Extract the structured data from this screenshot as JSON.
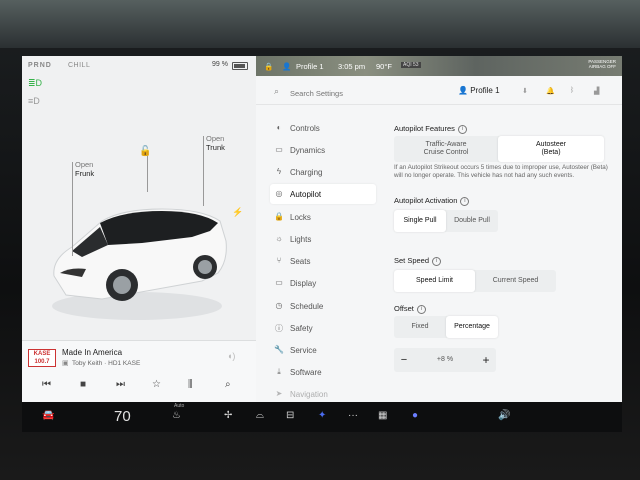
{
  "status": {
    "gears": "PRND",
    "gear_active": "P",
    "mode": "CHILL",
    "battery": "99 %"
  },
  "car": {
    "frunk_top": "Open",
    "frunk_bottom": "Frunk",
    "trunk_top": "Open",
    "trunk_bottom": "Trunk"
  },
  "media": {
    "station_logo": "KASE 100.7",
    "song": "Made In America",
    "artist": "Toby Keith · HD1 KASE"
  },
  "map_bar": {
    "profile": "Profile 1",
    "time": "3:05 pm",
    "temp": "90°F",
    "aqi": "AQI 53",
    "airbag": "PASSENGER AIRBAG OFF"
  },
  "header": {
    "search_placeholder": "Search Settings",
    "profile": "Profile 1"
  },
  "nav": {
    "items": [
      {
        "label": "Controls",
        "icon": "toggle-icon"
      },
      {
        "label": "Dynamics",
        "icon": "car-icon"
      },
      {
        "label": "Charging",
        "icon": "bolt-icon"
      },
      {
        "label": "Autopilot",
        "icon": "steering-wheel-icon"
      },
      {
        "label": "Locks",
        "icon": "lock-icon"
      },
      {
        "label": "Lights",
        "icon": "light-icon"
      },
      {
        "label": "Seats",
        "icon": "seat-icon"
      },
      {
        "label": "Display",
        "icon": "display-icon"
      },
      {
        "label": "Schedule",
        "icon": "clock-icon"
      },
      {
        "label": "Safety",
        "icon": "shield-icon"
      },
      {
        "label": "Service",
        "icon": "wrench-icon"
      },
      {
        "label": "Software",
        "icon": "download-icon"
      },
      {
        "label": "Navigation",
        "icon": "navigation-icon"
      }
    ],
    "active": "Autopilot"
  },
  "autopilot": {
    "features_title": "Autopilot Features",
    "features_opt1": "Traffic-Aware\nCruise Control",
    "features_opt2": "Autosteer\n(Beta)",
    "warning": "If an Autopilot Strikeout occurs 5 times due to improper use, Autosteer (Beta) will no longer operate. This vehicle has not had any such events.",
    "activation_title": "Autopilot Activation",
    "activation_opt1": "Single Pull",
    "activation_opt2": "Double Pull",
    "speed_title": "Set Speed",
    "speed_opt1": "Speed Limit",
    "speed_opt2": "Current Speed",
    "offset_title": "Offset",
    "offset_opt1": "Fixed",
    "offset_opt2": "Percentage",
    "offset_value": "+8 %",
    "offset_minus": "−",
    "offset_plus": "+"
  },
  "bottom": {
    "cabin_temp": "70",
    "auto": "Auto"
  },
  "colors": {
    "accent_green": "#36b24a",
    "screen_bg": "#f3f4f5"
  }
}
